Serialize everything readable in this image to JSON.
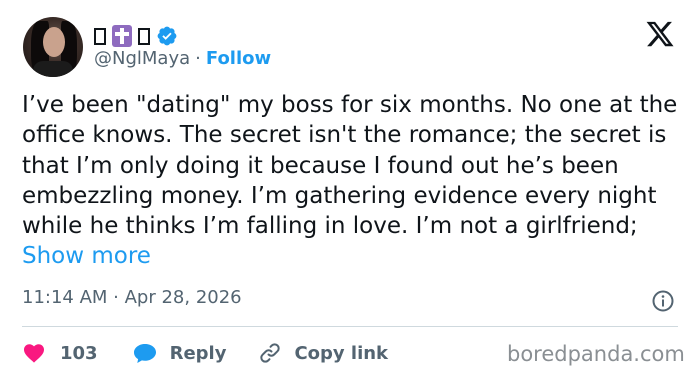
{
  "header": {
    "avatar_alt": "profile photo",
    "display_name_glyphs": [
      "box-glyph",
      "cross-glyph",
      "box-glyph"
    ],
    "handle": "@NglMaya",
    "separator": "·",
    "follow_label": "Follow",
    "platform_icon": "x-logo-icon"
  },
  "tweet": {
    "text": "I’ve been \"dating\" my boss for six months. No one at the office knows. The secret isn't the romance; the secret is that I’m only doing it because I found out he’s been embezzling money. I’m gathering evidence every night while he thinks I’m falling in love. I’m not a girlfriend; ",
    "show_more_label": "Show more",
    "timestamp": "11:14 AM · Apr 28, 2026"
  },
  "actions": {
    "like_count": "103",
    "reply_label": "Reply",
    "copy_link_label": "Copy link"
  },
  "watermark": "boredpanda.com",
  "colors": {
    "accent": "#1d9bf0",
    "like": "#f91880",
    "muted": "#536471",
    "text": "#0f1419"
  }
}
